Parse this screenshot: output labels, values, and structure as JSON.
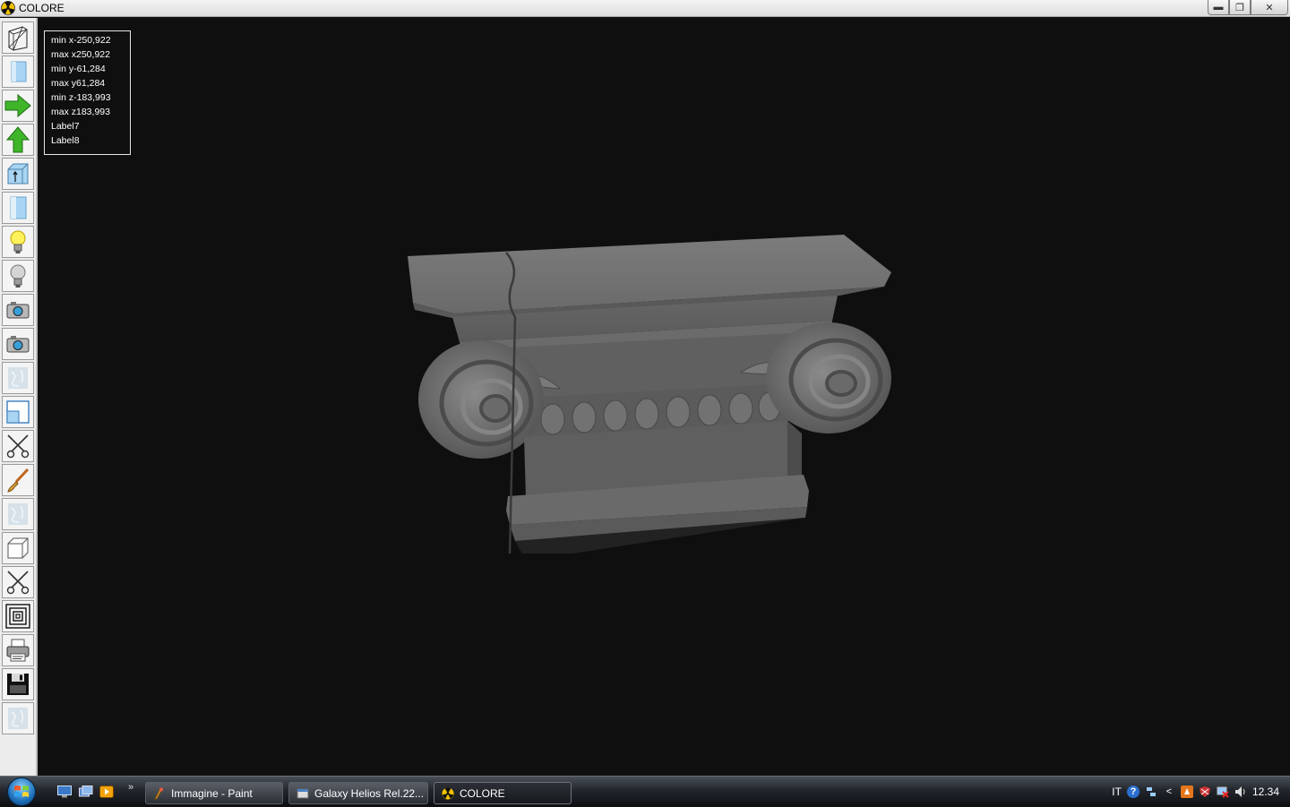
{
  "window": {
    "title": "COLORE",
    "minimize_symbol": "▬",
    "restore_symbol": "❐",
    "close_symbol": "✕"
  },
  "toolbar": {
    "tools": [
      {
        "name": "wireframe-view-icon"
      },
      {
        "name": "front-view-icon"
      },
      {
        "name": "arrow-right-icon"
      },
      {
        "name": "arrow-up-icon"
      },
      {
        "name": "axis-view-icon"
      },
      {
        "name": "side-view-icon"
      },
      {
        "name": "light-on-icon"
      },
      {
        "name": "light-off-icon"
      },
      {
        "name": "camera-icon"
      },
      {
        "name": "camera-alt-icon"
      },
      {
        "name": "texture-icon"
      },
      {
        "name": "window-split-icon"
      },
      {
        "name": "scissors-icon"
      },
      {
        "name": "paint-brush-icon"
      },
      {
        "name": "texture-alt-icon"
      },
      {
        "name": "cube-icon"
      },
      {
        "name": "scissors-alt-icon"
      },
      {
        "name": "concentric-squares-icon"
      },
      {
        "name": "printer-icon"
      },
      {
        "name": "save-floppy-icon"
      },
      {
        "name": "texture-disabled-icon"
      }
    ]
  },
  "info_panel": {
    "lines": [
      "min x-250,922",
      "max x250,922",
      "min y-61,284",
      "max y61,284",
      "min z-183,993",
      "max z183,993",
      "Label7",
      "Label8"
    ]
  },
  "taskbar": {
    "quicklaunch_more": "»",
    "tasks": [
      {
        "label": "Immagine - Paint",
        "icon": "paint-icon"
      },
      {
        "label": "Galaxy Helios  Rel.22...",
        "icon": "galaxy-icon"
      },
      {
        "label": "COLORE",
        "icon": "radiation-icon"
      }
    ],
    "tray": {
      "language": "IT",
      "help_symbol": "?",
      "arrow_symbol": "<",
      "clock": "12.34"
    }
  },
  "colors": {
    "viewport_bg": "#0f0f0f",
    "marble": "#6e6e6e",
    "icon_green": "#3fb52a",
    "radiation_yellow": "#f2c200"
  }
}
